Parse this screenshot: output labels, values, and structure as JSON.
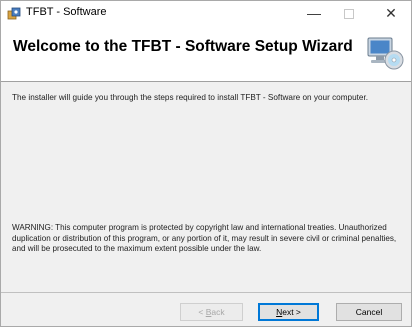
{
  "window": {
    "title": "TFBT - Software",
    "controls": {
      "minimize": "—",
      "close": "✕"
    }
  },
  "banner": {
    "heading": "Welcome to the TFBT - Software Setup Wizard"
  },
  "content": {
    "intro": "The installer will guide you through the steps required to install TFBT - Software on your computer.",
    "warning": "WARNING: This computer program is protected by copyright law and international treaties. Unauthorized duplication or distribution of this program, or any portion of it, may result in severe civil or criminal penalties, and will be prosecuted to the maximum extent possible under the law."
  },
  "buttons": {
    "back_prefix": "< ",
    "back_accel": "B",
    "back_rest": "ack",
    "next_accel": "N",
    "next_rest": "ext >",
    "cancel": "Cancel"
  },
  "colors": {
    "banner_background": "#ffffff",
    "body_background": "#f0f0f0",
    "focus_border": "#0078d7"
  },
  "icons": {
    "app": "installer-package-icon",
    "setup": "computer-setup-disc-icon"
  }
}
